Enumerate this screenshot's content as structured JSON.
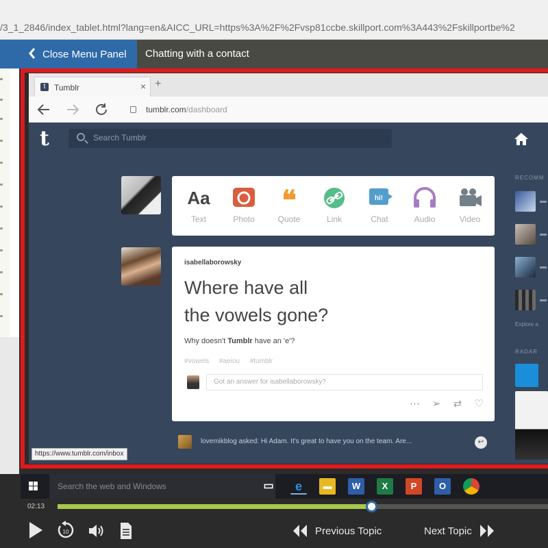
{
  "browser": {
    "url": "/3_1_2846/index_tablet.html?lang=en&AICC_URL=https%3A%2F%2Fvsp81ccbe.skillport.com%3A443%2Fskillportbe%2"
  },
  "course_header": {
    "close_menu_label": "Close Menu Panel",
    "title": "Chatting with a contact"
  },
  "inner_browser": {
    "tab_label": "Tumblr",
    "tab_close": "×",
    "new_tab": "+",
    "url_domain": "tumblr.com",
    "url_path": "/dashboard"
  },
  "tumblr": {
    "logo": "t",
    "search_placeholder": "Search Tumblr",
    "post_types": [
      {
        "icon": "Aa",
        "label": "Text",
        "color": "#444444"
      },
      {
        "icon": "camera-icon",
        "label": "Photo",
        "color": "#d95e40"
      },
      {
        "icon": "❝",
        "label": "Quote",
        "color": "#f2992e"
      },
      {
        "icon": "link-icon",
        "label": "Link",
        "color": "#56bc8a"
      },
      {
        "icon": "chat-icon",
        "label": "Chat",
        "color": "#529ecc"
      },
      {
        "icon": "audio-icon",
        "label": "Audio",
        "color": "#a77dc2"
      },
      {
        "icon": "video-icon",
        "label": "Video",
        "color": "#748089"
      }
    ],
    "post": {
      "author": "isabellaborowsky",
      "title_line1": "Where have all",
      "title_line2": "the vowels gone?",
      "body_prefix": "Why doesn't ",
      "body_bold": "Tumblr",
      "body_suffix": " have an 'e'?",
      "tags": [
        "#vowels",
        "#aeiou",
        "#tumblr"
      ],
      "answer_placeholder": "Got an answer for isabellaborowsky?"
    },
    "notification": {
      "text": "lovemikblog asked: Hi Adam. It's great to have you on the team. Are..."
    },
    "status_link": "https://www.tumblr.com/inbox",
    "right_col": {
      "recommended_label": "RECOMM",
      "explore_label": "Explore a",
      "radar_label": "RADAR"
    }
  },
  "taskbar": {
    "search_placeholder": "Search the web and Windows"
  },
  "player": {
    "elapsed": "02:13",
    "progress": 0.64,
    "prev_label": "Previous Topic",
    "next_label": "Next Topic"
  },
  "colors": {
    "accent_blue": "#2e6aa8",
    "highlight_red": "#e0191b",
    "tumblr_navy": "#36465d",
    "progress_green": "#a8c84a"
  }
}
